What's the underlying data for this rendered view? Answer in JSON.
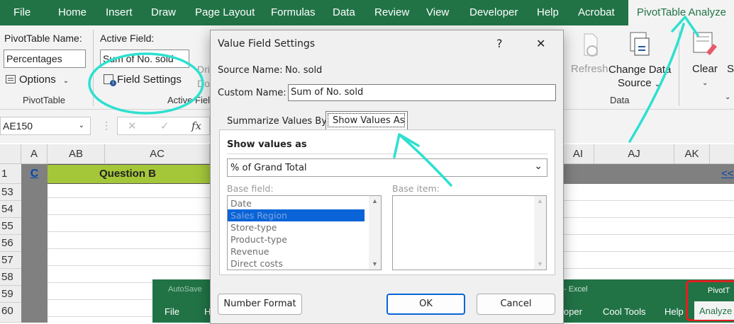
{
  "tabs": [
    "File",
    "Home",
    "Insert",
    "Draw",
    "Page Layout",
    "Formulas",
    "Data",
    "Review",
    "View",
    "Developer",
    "Help",
    "Acrobat",
    "PivotTable Analyze"
  ],
  "ribbon": {
    "pivottable_name_label": "PivotTable Name:",
    "pivottable_name_value": "Percentages",
    "options_label": "Options",
    "pivottable_group": "PivotTable",
    "active_field_label": "Active Field:",
    "active_field_value": "Sum of No. sold",
    "field_settings_label": "Field Settings",
    "active_field_group": "Active Field",
    "drill_down_partial": "Dri Dow",
    "refresh_label": "Refresh",
    "change_data_source_line1": "Change Data",
    "change_data_source_line2": "Source",
    "data_group": "Data",
    "clear_label": "Clear",
    "select_partial": "S"
  },
  "formula_bar": {
    "name_box": "AE150",
    "fx": "fx"
  },
  "grid": {
    "columns": [
      "A",
      "AB",
      "AC",
      "AI",
      "AJ",
      "AK"
    ],
    "row1": {
      "a": "C",
      "question": "Question B",
      "link": "<<"
    },
    "rows": [
      "1",
      "53",
      "54",
      "55",
      "56",
      "57",
      "58",
      "59",
      "60"
    ]
  },
  "dialog": {
    "title": "Value Field Settings",
    "help": "?",
    "close": "✕",
    "source_name_label": "Source Name:",
    "source_name_value": "No. sold",
    "custom_name_label": "Custom Name:",
    "custom_name_value": "Sum of No. sold",
    "tab_summarize": "Summarize Values By",
    "tab_show_values": "Show Values As",
    "show_values_as_heading": "Show values as",
    "show_values_as_selected": "% of Grand Total",
    "base_field_label": "Base field:",
    "base_item_label": "Base item:",
    "base_fields": [
      "Date",
      "Sales Region",
      "Store-type",
      "Product-type",
      "Revenue",
      "Direct costs"
    ],
    "base_field_selected_index": 1,
    "number_format_button": "Number Format",
    "ok_button": "OK",
    "cancel_button": "Cancel"
  },
  "embedded": {
    "autosave": "AutoSave",
    "title_partial": "- Excel",
    "pivot_partial": "PivotT",
    "tabs": [
      "File",
      "H",
      "loper",
      "Cool Tools",
      "Help",
      "Analyze"
    ]
  },
  "colors": {
    "excel_green": "#217346",
    "annotation_cyan": "#2ee0d0",
    "highlight_red": "#e02020",
    "selection_blue": "#0a64d8",
    "header_bar_green": "#a4c639"
  }
}
